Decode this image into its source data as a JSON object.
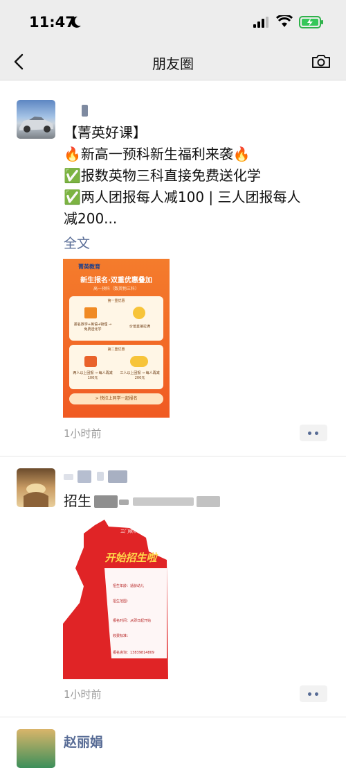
{
  "status_bar": {
    "time": "11:47"
  },
  "nav": {
    "title": "朋友圈",
    "back_icon": "chevron-left-icon",
    "camera_icon": "camera-icon"
  },
  "posts": [
    {
      "text_lines": [
        "【菁英好课】",
        "🔥新高一预科新生福利来袭🔥",
        "✅报数英物三科直接免费送化学",
        "✅两人团报每人减100 | 三人团报每人",
        "减200..."
      ],
      "full_text_link": "全文",
      "time_ago": "1小时前",
      "poster": {
        "brand": "菁英教育",
        "headline": "新生报名·双重优惠叠加",
        "sub": "高一预科（数英物三科）",
        "tier1_label": "第一重优惠",
        "tier1_left": "报名数学+英语+物理 → 免费送化学",
        "tier1_right": "价值直接拉满",
        "tier2_label": "第二重优惠",
        "tier2_left": "两人以上团报 → 每人再减 100元",
        "tier2_right": "三人以上团报 → 每人再减 200元",
        "cta": "> 快拉上同学一起报名"
      }
    },
    {
      "text_prefix": "招生",
      "time_ago": "1小时前",
      "poster": {
        "org": "三门峡市",
        "title": "开始招生啦",
        "rows": [
          "招生年龄：适龄幼儿",
          "招生范围：",
          "报名时间：从即日起开始",
          "收费标准：",
          "报名咨询：13839814809"
        ]
      }
    },
    {
      "name": "赵丽娟"
    }
  ],
  "colors": {
    "link": "#576b95",
    "bar_bg": "#ededed",
    "poster_orange": "#f26a25",
    "poster_red": "#e02426"
  }
}
